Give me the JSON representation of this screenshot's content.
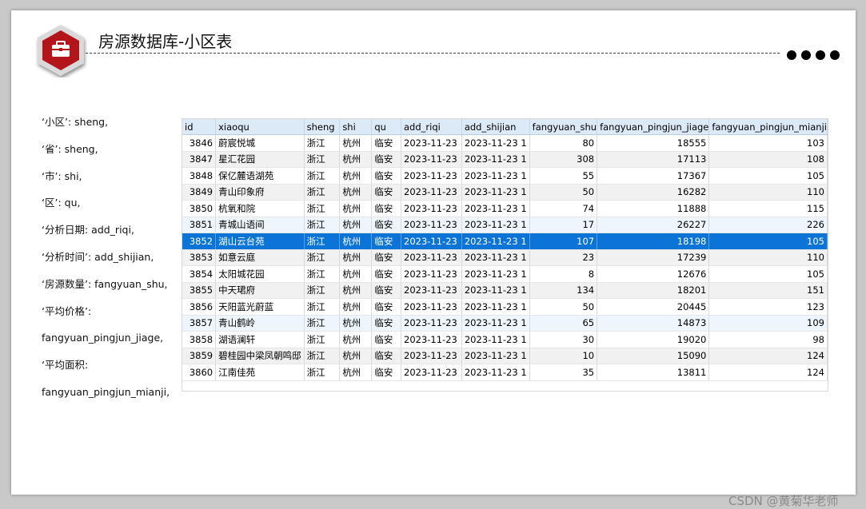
{
  "slide": {
    "title": "房源数据库-小区表",
    "watermark": "CSDN @黄菊华老师"
  },
  "colors": {
    "accent_red": "#b3151b",
    "selection_blue": "#0b74d6",
    "header_blue": "#dce9f7"
  },
  "icons": {
    "logo": "briefcase-icon"
  },
  "notes": [
    "‘小区’: sheng,",
    "‘省’: sheng,",
    "‘市’: shi,",
    "‘区’: qu,",
    "‘分析日期: add_riqi,",
    "‘分析时间’: add_shijian,",
    "‘房源数量’: fangyuan_shu,",
    "‘平均价格’:",
    "fangyuan_pingjun_jiage,",
    "‘平均面积:",
    "fangyuan_pingjun_mianji,"
  ],
  "table": {
    "columns": [
      "id",
      "xiaoqu",
      "sheng",
      "shi",
      "qu",
      "add_riqi",
      "add_shijian",
      "fangyuan_shu",
      "fangyuan_pingjun_jiage",
      "fangyuan_pingjun_mianji"
    ],
    "rows": [
      [
        "3846",
        "蔚宸悦城",
        "浙江",
        "杭州",
        "临安",
        "2023-11-23",
        "2023-11-23 1",
        "80",
        "18555",
        "103"
      ],
      [
        "3847",
        "星汇花园",
        "浙江",
        "杭州",
        "临安",
        "2023-11-23",
        "2023-11-23 1",
        "308",
        "17113",
        "108"
      ],
      [
        "3848",
        "保亿麓语湖苑",
        "浙江",
        "杭州",
        "临安",
        "2023-11-23",
        "2023-11-23 1",
        "55",
        "17367",
        "105"
      ],
      [
        "3849",
        "青山印象府",
        "浙江",
        "杭州",
        "临安",
        "2023-11-23",
        "2023-11-23 1",
        "50",
        "16282",
        "110"
      ],
      [
        "3850",
        "杭氧和院",
        "浙江",
        "杭州",
        "临安",
        "2023-11-23",
        "2023-11-23 1",
        "74",
        "11888",
        "115"
      ],
      [
        "3851",
        "青城山语间",
        "浙江",
        "杭州",
        "临安",
        "2023-11-23",
        "2023-11-23 1",
        "17",
        "26227",
        "226"
      ],
      [
        "3852",
        "湖山云台苑",
        "浙江",
        "杭州",
        "临安",
        "2023-11-23",
        "2023-11-23 1",
        "107",
        "18198",
        "105"
      ],
      [
        "3853",
        "如意云庭",
        "浙江",
        "杭州",
        "临安",
        "2023-11-23",
        "2023-11-23 1",
        "23",
        "17239",
        "110"
      ],
      [
        "3854",
        "太阳城花园",
        "浙江",
        "杭州",
        "临安",
        "2023-11-23",
        "2023-11-23 1",
        "8",
        "12676",
        "105"
      ],
      [
        "3855",
        "中天珺府",
        "浙江",
        "杭州",
        "临安",
        "2023-11-23",
        "2023-11-23 1",
        "134",
        "18201",
        "151"
      ],
      [
        "3856",
        "天阳蓝光蔚蓝",
        "浙江",
        "杭州",
        "临安",
        "2023-11-23",
        "2023-11-23 1",
        "50",
        "20445",
        "123"
      ],
      [
        "3857",
        "青山鹤岭",
        "浙江",
        "杭州",
        "临安",
        "2023-11-23",
        "2023-11-23 1",
        "65",
        "14873",
        "109"
      ],
      [
        "3858",
        "湖语澜轩",
        "浙江",
        "杭州",
        "临安",
        "2023-11-23",
        "2023-11-23 1",
        "30",
        "19020",
        "98"
      ],
      [
        "3859",
        "碧桂园中梁凤朝鸣邸",
        "浙江",
        "杭州",
        "临安",
        "2023-11-23",
        "2023-11-23 1",
        "10",
        "15090",
        "124"
      ],
      [
        "3860",
        "江南佳苑",
        "浙江",
        "杭州",
        "临安",
        "2023-11-23",
        "2023-11-23 1",
        "35",
        "13811",
        "124"
      ]
    ],
    "selected_row": 6
  }
}
